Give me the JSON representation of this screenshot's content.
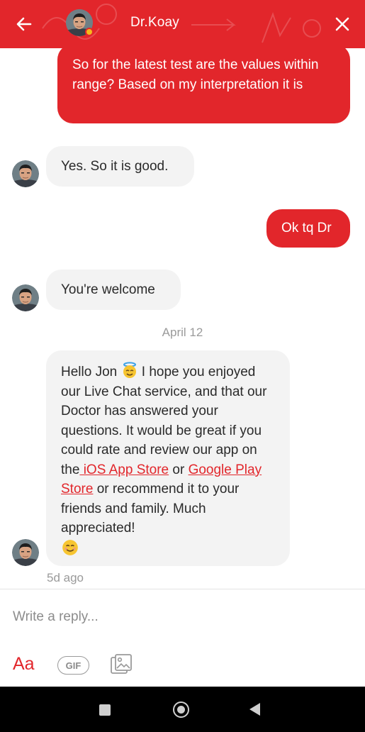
{
  "header": {
    "title": "Dr.Koay",
    "back_icon": "arrow-left-icon",
    "close_icon": "close-icon",
    "status": "away"
  },
  "messages": [
    {
      "direction": "out",
      "text": "So for the latest test are the values within range? Based on my interpretation it is"
    },
    {
      "direction": "in",
      "text": "Yes. So it is good."
    },
    {
      "direction": "out",
      "text": "Ok tq Dr"
    },
    {
      "direction": "in",
      "text": "You're welcome"
    },
    {
      "direction": "in",
      "parts": {
        "p1": "Hello Jon",
        "p2": " I hope you enjoyed our Live Chat service, and that our Doctor has answered your questions. It would be great if you could rate and review our app on the",
        "link1": " iOS App Store",
        "p3": " or ",
        "link2": "Google Play Store",
        "p4": " or recommend it to your friends and family. Much appreciated!"
      },
      "emojis": [
        "smiling-face-with-halo",
        "smiling-face"
      ]
    }
  ],
  "date_separator": "April 12",
  "last_seen": "5d ago",
  "composer": {
    "placeholder": "Write a reply...",
    "text_format_label": "Aa",
    "gif_label": "GIF",
    "image_icon": "image-icon"
  },
  "colors": {
    "brand": "#e2262b",
    "incoming_bubble": "#f3f3f3",
    "muted": "#9a9a9a"
  },
  "navbar": {
    "icons": [
      "recents-square-icon",
      "home-circle-icon",
      "back-triangle-icon"
    ]
  }
}
